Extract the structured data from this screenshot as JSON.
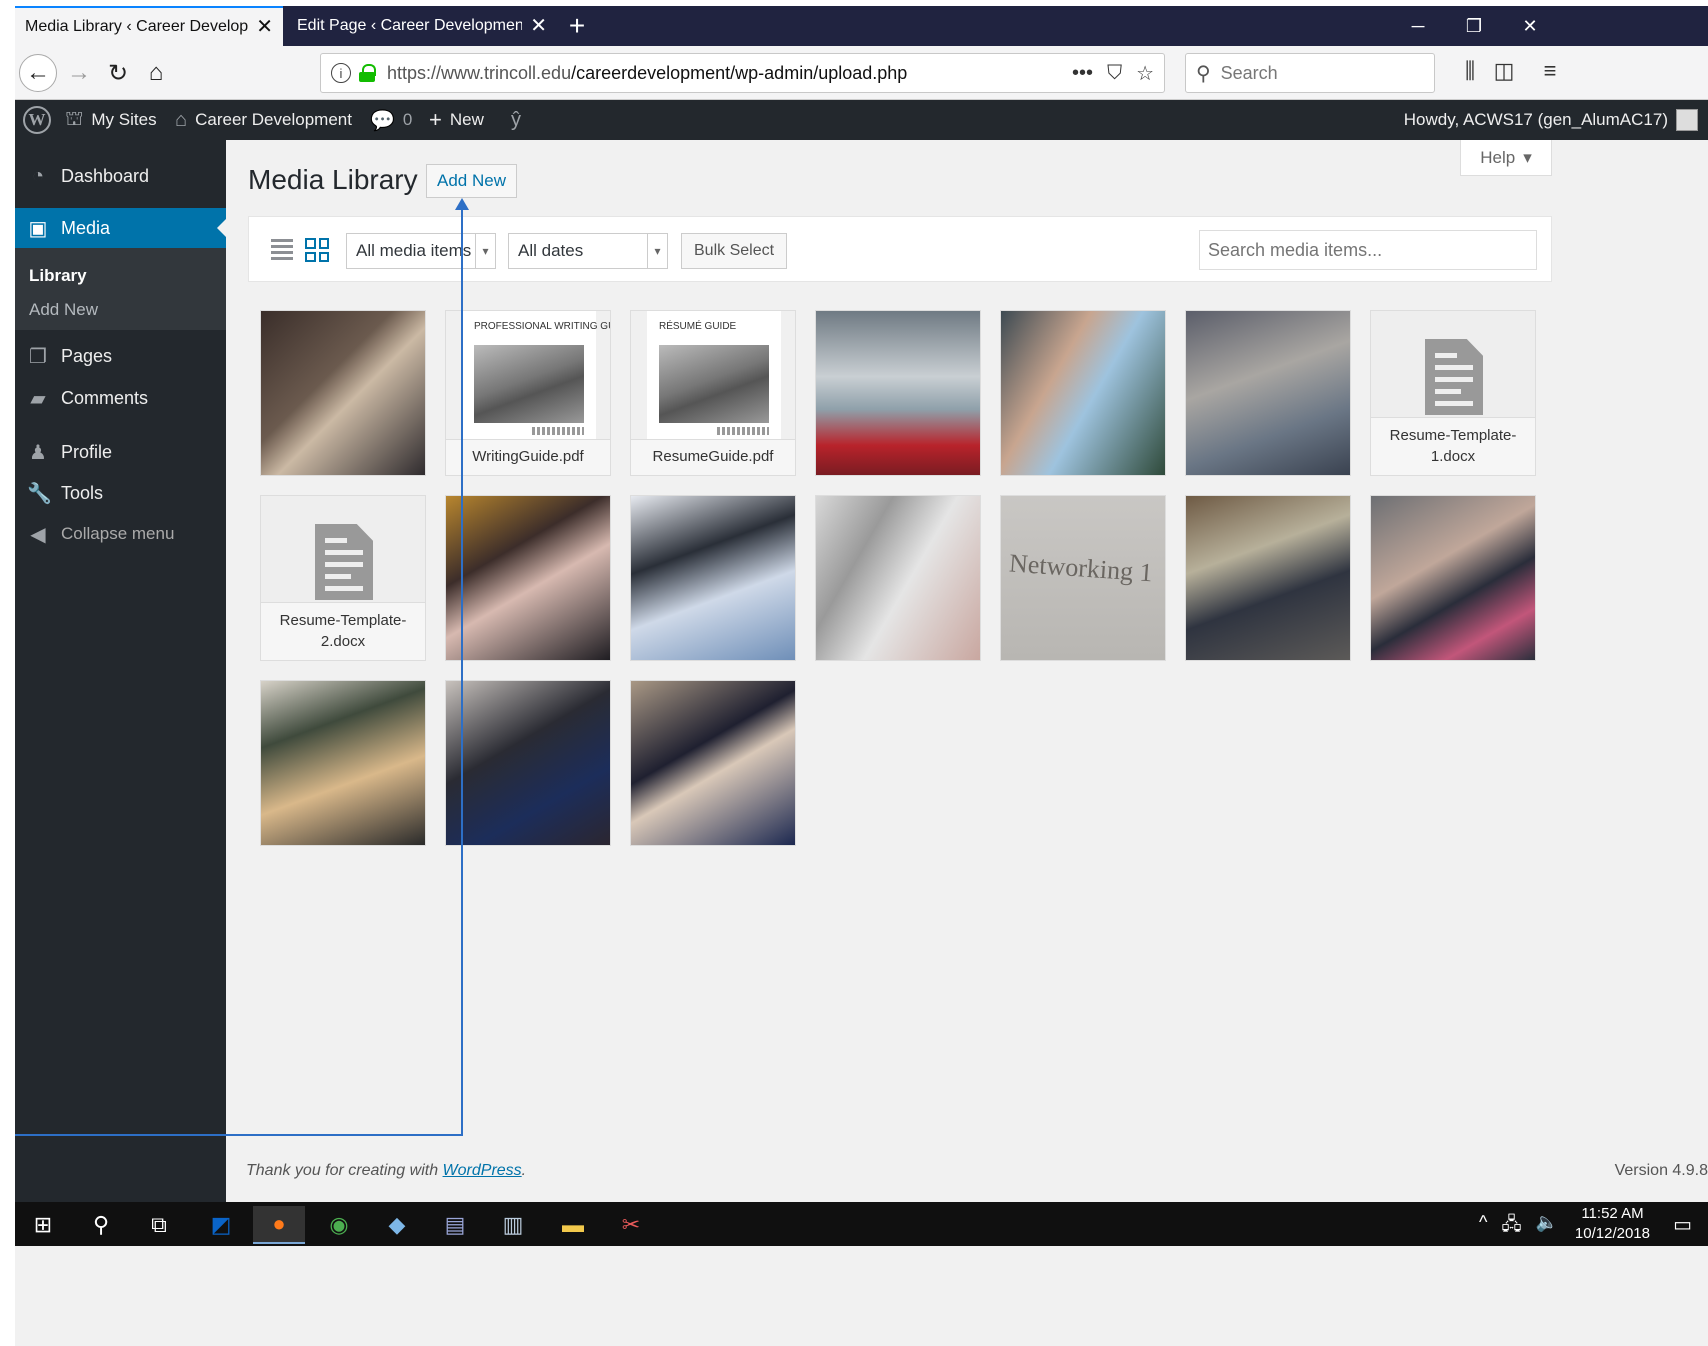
{
  "browser": {
    "tabs": [
      {
        "title": "Media Library ‹ Career Development",
        "active": true
      },
      {
        "title": "Edit Page ‹ Career Development —",
        "active": false
      }
    ],
    "new_tab": "+",
    "url_host": "https://www.trincoll.edu",
    "url_path": "/careerdevelopment/wp-admin/upload.php",
    "search_placeholder": "Search",
    "window_controls": {
      "minimize": "─",
      "restore": "❐",
      "close": "✕"
    }
  },
  "admin_bar": {
    "my_sites": "My Sites",
    "site_name": "Career Development",
    "comments_count": "0",
    "new_label": "New",
    "greeting": "Howdy, ACWS17 (gen_AlumAC17)"
  },
  "sidebar": {
    "dashboard": "Dashboard",
    "media": "Media",
    "library": "Library",
    "add_new": "Add New",
    "pages": "Pages",
    "comments": "Comments",
    "profile": "Profile",
    "tools": "Tools",
    "collapse": "Collapse menu"
  },
  "main": {
    "title": "Media Library",
    "add_new_button": "Add New",
    "help_label": "Help",
    "filter_type": "All media items",
    "filter_dates": "All dates",
    "bulk_select": "Bulk Select",
    "search_placeholder": "Search media items...",
    "media_items": [
      {
        "kind": "photo",
        "caption": ""
      },
      {
        "kind": "pdf",
        "caption": "WritingGuide.pdf",
        "heading": "PROFESSIONAL WRITING GUIDE"
      },
      {
        "kind": "pdf",
        "caption": "ResumeGuide.pdf",
        "heading": "RÉSUMÉ GUIDE"
      },
      {
        "kind": "photo",
        "caption": ""
      },
      {
        "kind": "photo",
        "caption": ""
      },
      {
        "kind": "photo",
        "caption": ""
      },
      {
        "kind": "doc",
        "caption": "Resume-Template-1.docx"
      },
      {
        "kind": "doc",
        "caption": "Resume-Template-2.docx"
      },
      {
        "kind": "photo",
        "caption": ""
      },
      {
        "kind": "photo",
        "caption": ""
      },
      {
        "kind": "photo",
        "caption": ""
      },
      {
        "kind": "photo",
        "caption": "Networking 1"
      },
      {
        "kind": "photo",
        "caption": ""
      },
      {
        "kind": "photo",
        "caption": ""
      },
      {
        "kind": "photo",
        "caption": ""
      },
      {
        "kind": "photo",
        "caption": ""
      },
      {
        "kind": "photo",
        "caption": ""
      }
    ]
  },
  "footer": {
    "thanks_prefix": "Thank you for creating with ",
    "thanks_link": "WordPress",
    "thanks_suffix": ".",
    "version": "Version 4.9.8"
  },
  "taskbar": {
    "time": "11:52 AM",
    "date": "10/12/2018"
  },
  "colors": {
    "accent": "#0073aa",
    "admin_bg": "#23282d",
    "annotation": "#2d6fc6"
  }
}
